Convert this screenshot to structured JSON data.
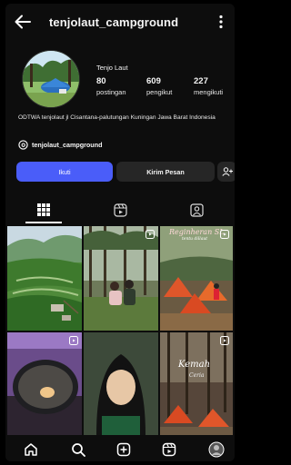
{
  "header": {
    "username": "tenjolaut_campground"
  },
  "profile": {
    "display_name": "Tenjo Laut",
    "stats": [
      {
        "value": "80",
        "label": "postingan"
      },
      {
        "value": "609",
        "label": "pengikut"
      },
      {
        "value": "227",
        "label": "mengikuti"
      }
    ],
    "bio": "ODTWA tenjolaut jl Cisantana-palutungan Kuningan Jawa Barat Indonesia",
    "threads_handle": "tenjolaut_campground"
  },
  "actions": {
    "follow_label": "Ikuti",
    "message_label": "Kirim Pesan"
  },
  "tabs": [
    {
      "icon": "grid-icon",
      "active": true
    },
    {
      "icon": "reels-icon",
      "active": false
    },
    {
      "icon": "tagged-icon",
      "active": false
    }
  ],
  "posts": [
    {
      "scene": "aerial-green-valley-terraces",
      "reel": false
    },
    {
      "scene": "couple-in-pine-forest",
      "reel": true
    },
    {
      "scene": "orange-tents-group",
      "reel": true,
      "caption_1": "Reginheran SL",
      "caption_2": "tentu dillaut"
    },
    {
      "scene": "frying-pan-cooking",
      "reel": true
    },
    {
      "scene": "hijab-selfie",
      "reel": false
    },
    {
      "scene": "forest-camp-tents",
      "reel": true,
      "caption_1": "Kemah",
      "caption_2": "Ceria"
    }
  ],
  "bottom_nav": [
    "home-icon",
    "search-icon",
    "create-icon",
    "reels-icon",
    "profile-avatar"
  ],
  "colors": {
    "follow": "#4a5df9",
    "secondary_button": "#262626",
    "background": "#0d0d0d"
  }
}
